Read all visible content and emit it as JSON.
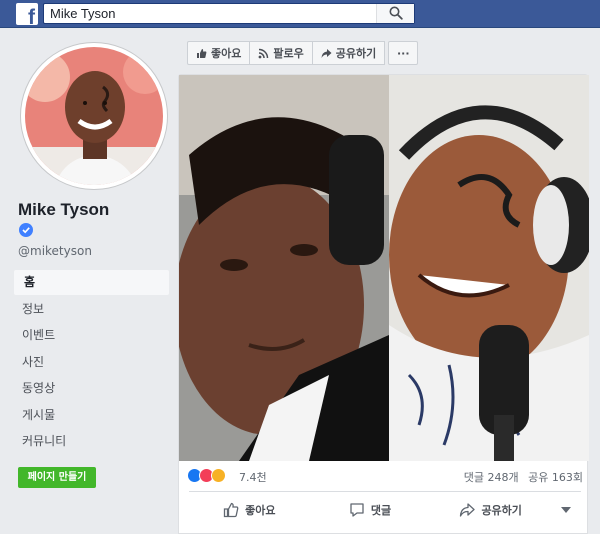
{
  "topbar": {
    "logo_letter": "f",
    "search_value": "Mike Tyson"
  },
  "sidebar": {
    "page_name": "Mike Tyson",
    "handle": "@miketyson",
    "nav": [
      {
        "label": "홈",
        "active": true
      },
      {
        "label": "정보"
      },
      {
        "label": "이벤트"
      },
      {
        "label": "사진"
      },
      {
        "label": "동영상"
      },
      {
        "label": "게시물"
      },
      {
        "label": "커뮤니티"
      }
    ],
    "create_page": "페이지 만들기"
  },
  "actionbar": {
    "like": "좋아요",
    "follow": "팔로우",
    "share": "공유하기",
    "more": "···"
  },
  "post": {
    "reaction_count": "7.4천",
    "comments": "댓글 248개",
    "shares": "공유 163회",
    "actions": {
      "like": "좋아요",
      "comment": "댓글",
      "share": "공유하기"
    }
  },
  "colors": {
    "topbar": "#3b5998",
    "create_button": "#42b72a",
    "verified": "#4080ff",
    "like": "#1877f2",
    "love": "#f33e58",
    "haha": "#f7b125"
  }
}
